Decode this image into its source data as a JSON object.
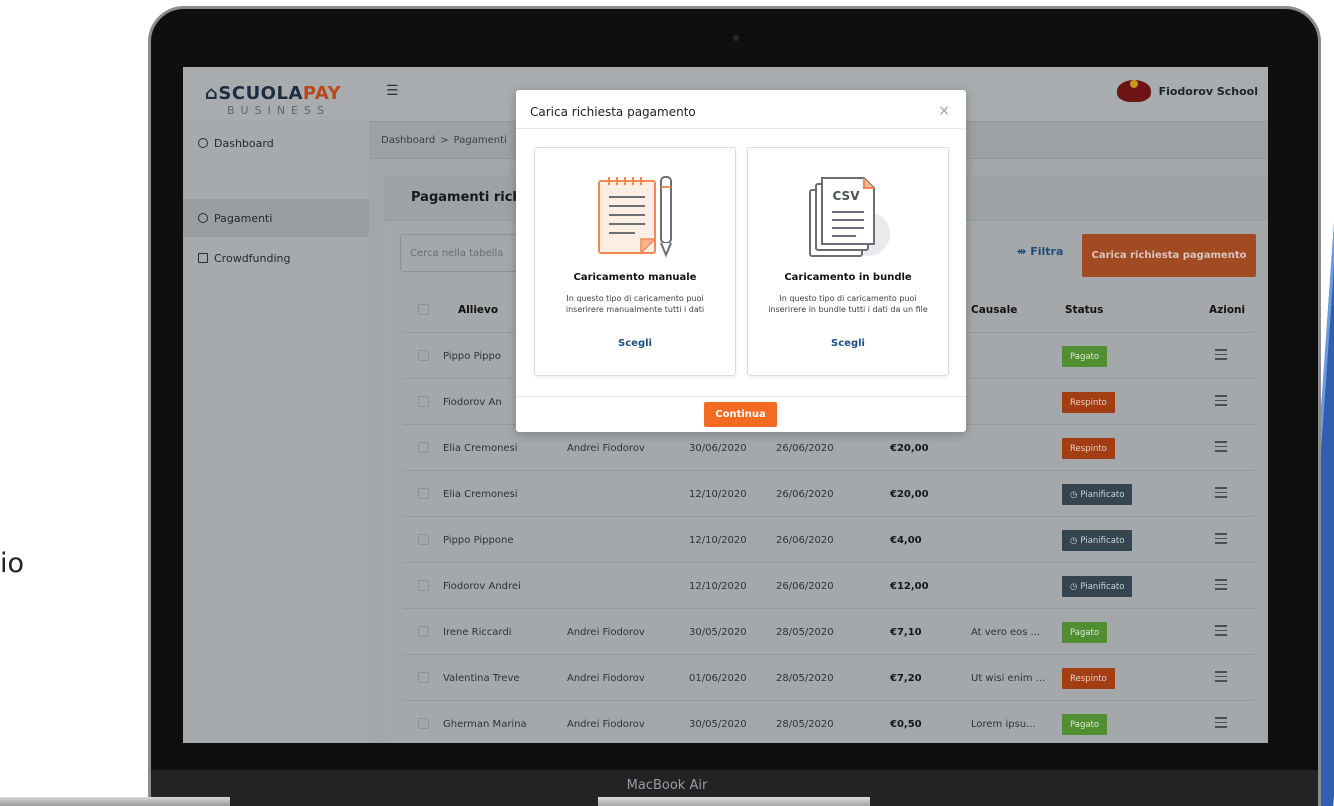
{
  "background": {
    "left_text": "io",
    "blue_accent": "#2f5fae"
  },
  "device": {
    "brand": "MacBook Air"
  },
  "app": {
    "logo_main": "SCUOLA",
    "logo_accent": "PAY",
    "logo_sub": "BUSINESS",
    "menu_icon": "menu-toggle-icon",
    "school_name": "Fiodorov School",
    "accent_color": "#f36b23",
    "link_color": "#1c4f80"
  },
  "sidebar": {
    "items": [
      {
        "label": "Dashboard",
        "icon": "dashboard-icon"
      },
      {
        "label": "Pagamenti",
        "icon": "payment-icon",
        "active": true
      },
      {
        "label": "Crowdfunding",
        "icon": "crowdfunding-icon"
      }
    ]
  },
  "breadcrumb": {
    "items": [
      "Dashboard",
      "Pagamenti"
    ],
    "separator": ">"
  },
  "card": {
    "title": "Pagamenti richi",
    "search_placeholder": "Cerca nella tabella",
    "filter_label": "Filtra",
    "upload_button": "Carica richiesta pagamento"
  },
  "table": {
    "headers": [
      "Allievo",
      "",
      "",
      "",
      "",
      "Causale",
      "Status",
      "Azioni"
    ],
    "rows": [
      {
        "allievo": "Pippo Pippo",
        "tutor": "",
        "data1": "",
        "data2": "",
        "importo": "",
        "causale": "",
        "status": "Pagato",
        "status_type": "pagato"
      },
      {
        "allievo": "Fiodorov An",
        "tutor": "",
        "data1": "",
        "data2": "",
        "importo": "",
        "causale": "",
        "status": "Respinto",
        "status_type": "respinto"
      },
      {
        "allievo": "Elia Cremonesi",
        "tutor": "Andrei Fiodorov",
        "data1": "30/06/2020",
        "data2": "26/06/2020",
        "importo": "€20,00",
        "causale": "",
        "status": "Respinto",
        "status_type": "respinto"
      },
      {
        "allievo": "Elia Cremonesi",
        "tutor": "",
        "data1": "12/10/2020",
        "data2": "26/06/2020",
        "importo": "€20,00",
        "causale": "",
        "status": "Pianificato",
        "status_type": "pianificato"
      },
      {
        "allievo": "Pippo Pippone",
        "tutor": "",
        "data1": "12/10/2020",
        "data2": "26/06/2020",
        "importo": "€4,00",
        "causale": "",
        "status": "Pianificato",
        "status_type": "pianificato"
      },
      {
        "allievo": "Fiodorov Andrei",
        "tutor": "",
        "data1": "12/10/2020",
        "data2": "26/06/2020",
        "importo": "€12,00",
        "causale": "",
        "status": "Pianificato",
        "status_type": "pianificato"
      },
      {
        "allievo": "Irene Riccardi",
        "tutor": "Andrei Fiodorov",
        "data1": "30/05/2020",
        "data2": "28/05/2020",
        "importo": "€7,10",
        "causale": "At vero eos ...",
        "status": "Pagato",
        "status_type": "pagato"
      },
      {
        "allievo": "Valentina Treve",
        "tutor": "Andrei Fiodorov",
        "data1": "01/06/2020",
        "data2": "28/05/2020",
        "importo": "€7,20",
        "causale": "Ut wisi enim ...",
        "status": "Respinto",
        "status_type": "respinto"
      },
      {
        "allievo": "Gherman Marina",
        "tutor": "Andrei Fiodorov",
        "data1": "30/05/2020",
        "data2": "28/05/2020",
        "importo": "€0,50",
        "causale": "Lorem ipsu...",
        "status": "Pagato",
        "status_type": "pagato"
      }
    ]
  },
  "modal": {
    "title": "Carica richiesta pagamento",
    "close": "×",
    "options": [
      {
        "icon": "notepad-pencil-icon",
        "title": "Caricamento manuale",
        "desc": "In questo tipo di caricamento puoi inserirere manualmente tutti i dati",
        "link": "Scegli"
      },
      {
        "icon": "csv-file-icon",
        "icon_text": "CSV",
        "title": "Caricamento in bundle",
        "desc": "In questo tipo di caricamento puoi inserirere in bundle tutti i dati da un file",
        "link": "Scegli"
      }
    ],
    "continue_button": "Continua"
  }
}
